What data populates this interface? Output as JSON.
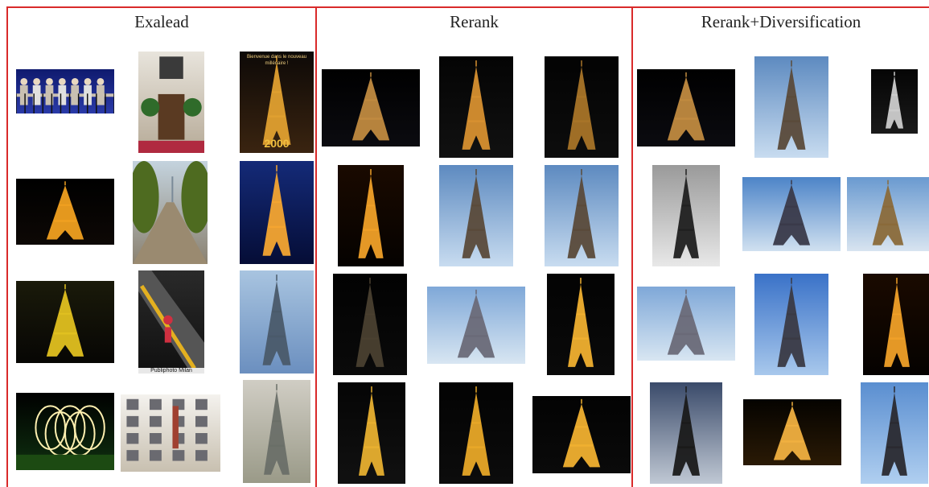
{
  "columns": [
    {
      "title": "Exalead",
      "thumbs": [
        {
          "icon": "people-on-balcony-icon",
          "palette": {
            "bg1": "#0f1a6e",
            "bg2": "#2a3aa8",
            "accent": "#c9c0b2"
          }
        },
        {
          "icon": "hotel-entrance-icon",
          "palette": {
            "bg1": "#e8e4dc",
            "bg2": "#b6aa97",
            "accent": "#2f6b2a"
          }
        },
        {
          "icon": "eiffel-tower-icon",
          "palette": {
            "bg1": "#0d0907",
            "bg2": "#3a2410",
            "accent": "#e0a030"
          },
          "caption": "Bienvenue dans le nouveau millénaire !",
          "caption2": "2000"
        },
        {
          "icon": "eiffel-tower-icon",
          "palette": {
            "bg1": "#000000",
            "bg2": "#0d0805",
            "accent": "#f0a020"
          }
        },
        {
          "icon": "tree-lined-path-icon",
          "palette": {
            "bg1": "#c4d3de",
            "bg2": "#8a8170",
            "accent": "#4e6b20"
          }
        },
        {
          "icon": "eiffel-tower-icon",
          "palette": {
            "bg1": "#142a78",
            "bg2": "#050d36",
            "accent": "#f4a531"
          }
        },
        {
          "icon": "eiffel-tower-icon",
          "palette": {
            "bg1": "#1a1a0a",
            "bg2": "#070604",
            "accent": "#e0c020"
          }
        },
        {
          "icon": "escalator-icon",
          "palette": {
            "bg1": "#2a2a2a",
            "bg2": "#101010",
            "accent": "#e3b020"
          },
          "caption": "Publiphoto Milan"
        },
        {
          "icon": "eiffel-tower-icon",
          "palette": {
            "bg1": "#a8c4e0",
            "bg2": "#6b8fbf",
            "accent": "#4a5a6a"
          }
        },
        {
          "icon": "light-rings-icon",
          "palette": {
            "bg1": "#000000",
            "bg2": "#0f3010",
            "accent": "#fff0b0"
          }
        },
        {
          "icon": "building-facade-icon",
          "palette": {
            "bg1": "#f4f2ee",
            "bg2": "#c8c0b0",
            "accent": "#a04030"
          }
        },
        {
          "icon": "eiffel-tower-icon",
          "palette": {
            "bg1": "#d0cdc4",
            "bg2": "#9a9a88",
            "accent": "#6a6f68"
          }
        }
      ]
    },
    {
      "title": "Rerank",
      "thumbs": [
        {
          "icon": "eiffel-tower-icon",
          "palette": {
            "bg1": "#000000",
            "bg2": "#0b0b10",
            "accent": "#c08a40"
          }
        },
        {
          "icon": "eiffel-tower-icon",
          "palette": {
            "bg1": "#040404",
            "bg2": "#111111",
            "accent": "#d79030"
          }
        },
        {
          "icon": "eiffel-tower-icon",
          "palette": {
            "bg1": "#030303",
            "bg2": "#0d0d0d",
            "accent": "#a87428"
          }
        },
        {
          "icon": "eiffel-tower-icon",
          "palette": {
            "bg1": "#1a0a00",
            "bg2": "#050200",
            "accent": "#f0a028"
          }
        },
        {
          "icon": "eiffel-tower-icon",
          "palette": {
            "bg1": "#5d8ac0",
            "bg2": "#c8dcf0",
            "accent": "#5a4a3a"
          }
        },
        {
          "icon": "eiffel-tower-icon",
          "palette": {
            "bg1": "#5d8ac0",
            "bg2": "#c8dcf0",
            "accent": "#5a4a3a"
          }
        },
        {
          "icon": "eiffel-tower-icon",
          "palette": {
            "bg1": "#020202",
            "bg2": "#0a0a0a",
            "accent": "#4a4030"
          }
        },
        {
          "icon": "eiffel-tower-icon",
          "palette": {
            "bg1": "#7fa8d8",
            "bg2": "#d8e6f2",
            "accent": "#6a6a78"
          }
        },
        {
          "icon": "eiffel-tower-icon",
          "palette": {
            "bg1": "#030303",
            "bg2": "#0a0a0a",
            "accent": "#f0b030"
          }
        },
        {
          "icon": "eiffel-tower-icon",
          "palette": {
            "bg1": "#050505",
            "bg2": "#111111",
            "accent": "#e8b030"
          }
        },
        {
          "icon": "eiffel-tower-icon",
          "palette": {
            "bg1": "#030303",
            "bg2": "#0c0c0c",
            "accent": "#e8a828"
          }
        },
        {
          "icon": "eiffel-tower-icon",
          "palette": {
            "bg1": "#030303",
            "bg2": "#0a0a0a",
            "accent": "#f0b030"
          }
        }
      ]
    },
    {
      "title": "Rerank+Diversification",
      "thumbs": [
        {
          "icon": "eiffel-tower-icon",
          "palette": {
            "bg1": "#000000",
            "bg2": "#0b0b10",
            "accent": "#c08a40"
          }
        },
        {
          "icon": "eiffel-tower-icon",
          "palette": {
            "bg1": "#5d8ac0",
            "bg2": "#c8dcf0",
            "accent": "#5a4a3a"
          }
        },
        {
          "icon": "eiffel-tower-icon",
          "palette": {
            "bg1": "#050505",
            "bg2": "#1a1a1a",
            "accent": "#cccccc"
          }
        },
        {
          "icon": "eiffel-tower-icon",
          "palette": {
            "bg1": "#9a9a9a",
            "bg2": "#e8e8e8",
            "accent": "#202020"
          }
        },
        {
          "icon": "eiffel-tower-icon",
          "palette": {
            "bg1": "#4d84c8",
            "bg2": "#d0e0f0",
            "accent": "#3a3a4a"
          }
        },
        {
          "icon": "eiffel-tower-icon",
          "palette": {
            "bg1": "#6a9ad0",
            "bg2": "#d8e4f0",
            "accent": "#8a6a3a"
          }
        },
        {
          "icon": "eiffel-tower-icon",
          "palette": {
            "bg1": "#7fa8d8",
            "bg2": "#d8e6f2",
            "accent": "#6a6a78"
          }
        },
        {
          "icon": "eiffel-tower-icon",
          "palette": {
            "bg1": "#3a72c8",
            "bg2": "#a8c8ec",
            "accent": "#3a3a44"
          }
        },
        {
          "icon": "eiffel-tower-icon",
          "palette": {
            "bg1": "#1a0a00",
            "bg2": "#050200",
            "accent": "#f0a028"
          }
        },
        {
          "icon": "eiffel-tower-icon",
          "palette": {
            "bg1": "#3a4a6a",
            "bg2": "#c0c8d4",
            "accent": "#1a1a1a"
          }
        },
        {
          "icon": "eiffel-tower-icon",
          "palette": {
            "bg1": "#050300",
            "bg2": "#2a1a05",
            "accent": "#f0b040"
          }
        },
        {
          "icon": "eiffel-tower-icon",
          "palette": {
            "bg1": "#5a8ed0",
            "bg2": "#b0cff0",
            "accent": "#2a2a30"
          }
        }
      ]
    }
  ]
}
